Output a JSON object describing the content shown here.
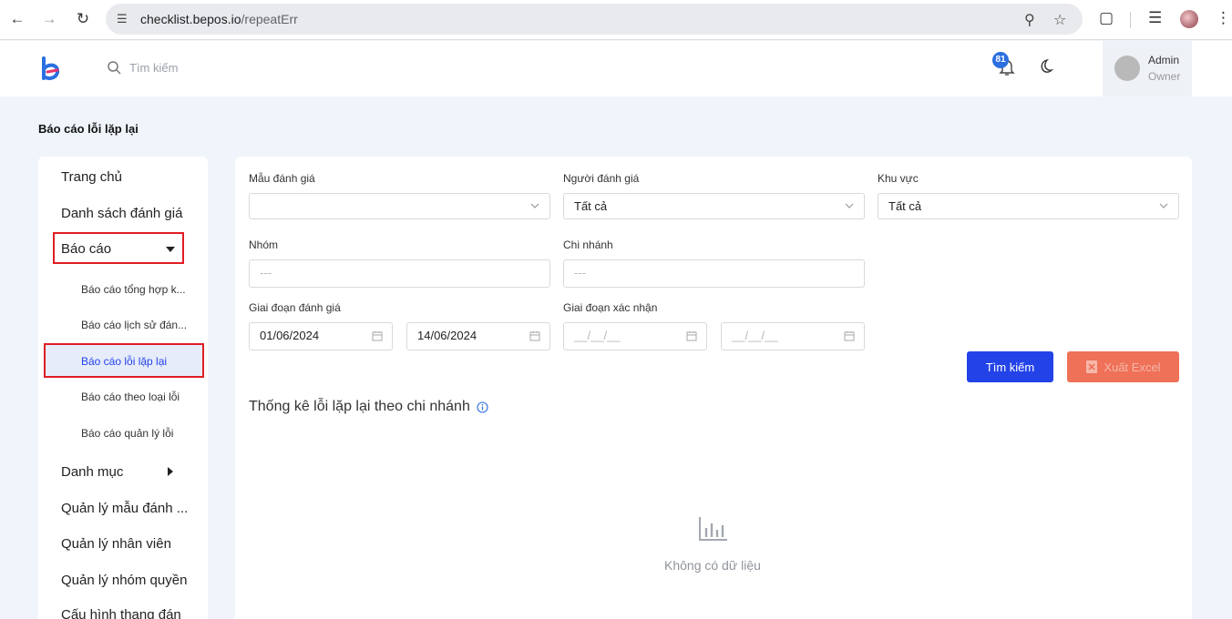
{
  "browser": {
    "url_host": "checklist.bepos.io",
    "url_path": "/repeatErr",
    "icons": [
      "back-icon",
      "forward-icon",
      "reload-icon",
      "site-info-icon",
      "zoom-icon",
      "star-icon",
      "extensions-icon",
      "media-icon",
      "profile-avatar",
      "menu-icon"
    ]
  },
  "header": {
    "search_placeholder": "Tìm kiếm",
    "notification_count": "81",
    "user_name": "Admin",
    "user_role": "Owner"
  },
  "page": {
    "title": "Báo cáo lỗi lặp lại"
  },
  "sidebar": {
    "items": [
      {
        "label": "Trang chủ"
      },
      {
        "label": "Danh sách đánh giá"
      },
      {
        "label": "Báo cáo"
      },
      {
        "label": "Danh mục"
      },
      {
        "label": "Quản lý mẫu đánh ..."
      },
      {
        "label": "Quản lý nhân viên"
      },
      {
        "label": "Quản lý nhóm quyền"
      },
      {
        "label": "Cấu hình thang đán"
      }
    ],
    "report_subitems": [
      {
        "label": "Báo cáo tổng hợp k..."
      },
      {
        "label": "Báo cáo lịch sử đán..."
      },
      {
        "label": "Báo cáo lỗi lặp lại"
      },
      {
        "label": "Báo cáo theo loại lỗi"
      },
      {
        "label": "Báo cáo quản lý lỗi"
      }
    ]
  },
  "filters": {
    "template_label": "Mẫu đánh giá",
    "template_value": "",
    "evaluator_label": "Người đánh giá",
    "evaluator_value": "Tất cả",
    "region_label": "Khu vực",
    "region_value": "Tất cả",
    "group_label": "Nhóm",
    "group_placeholder": "---",
    "branch_label": "Chi nhánh",
    "branch_placeholder": "---",
    "eval_period_label": "Giai đoạn đánh giá",
    "eval_from": "01/06/2024",
    "eval_to": "14/06/2024",
    "confirm_period_label": "Giai đoạn xác nhận",
    "confirm_from_placeholder": "__/__/__",
    "confirm_to_placeholder": "__/__/__"
  },
  "actions": {
    "search_label": "Tìm kiếm",
    "export_label": "Xuất Excel"
  },
  "stats": {
    "title": "Thống kê lỗi lặp lại theo chi nhánh",
    "empty_text": "Không có dữ liệu"
  },
  "colors": {
    "primary": "#2343e8",
    "export": "#ee7158",
    "highlight": "#e01d24",
    "badge": "#2b6fe0",
    "background": "#f0f5fb"
  }
}
